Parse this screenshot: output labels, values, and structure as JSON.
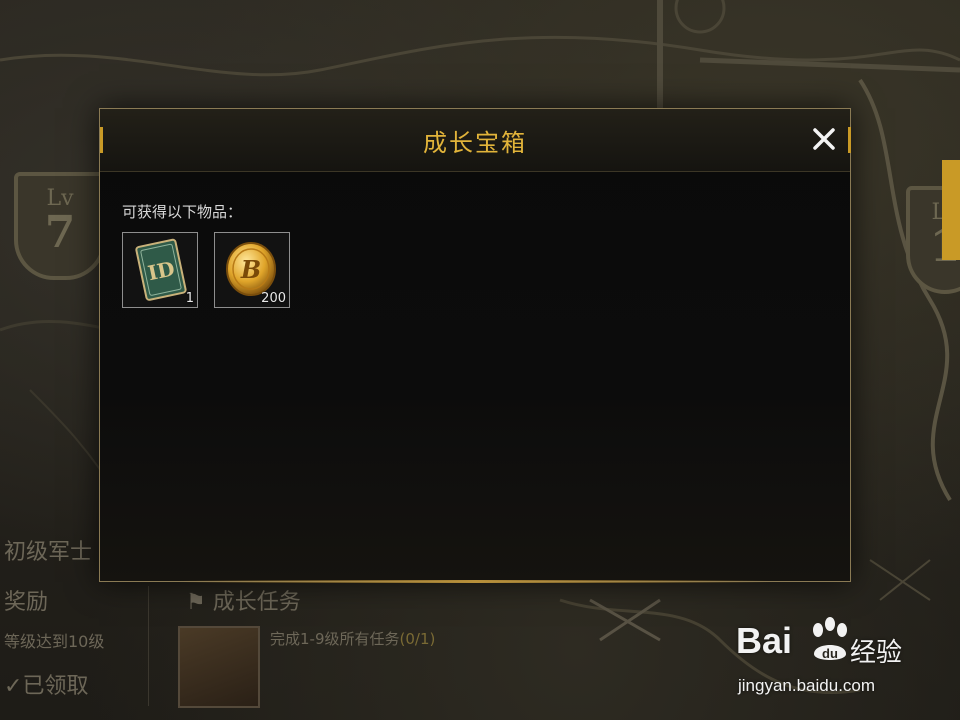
{
  "background": {
    "level_badge_left": {
      "lv": "Lv",
      "number": "7"
    },
    "level_badge_right": {
      "lv": "Lv",
      "number": "1"
    },
    "rank_label": "初级军士",
    "reward_label": "奖励",
    "level_requirement": "等级达到10级",
    "claimed_label": "已领取",
    "growth_task_label": "成长任务",
    "task_description": "完成1-9级所有任务",
    "task_progress": "(0/1)"
  },
  "dialog": {
    "title": "成长宝箱",
    "close_icon": "close-icon",
    "subtitle": "可获得以下物品：",
    "items": [
      {
        "icon": "id-card-icon",
        "quantity": "1"
      },
      {
        "icon": "bp-coin-icon",
        "quantity": "200"
      }
    ]
  },
  "watermark": {
    "logo_text": "Bai",
    "logo_suffix": "du",
    "label": "经验",
    "url": "jingyan.baidu.com"
  },
  "colors": {
    "accent_gold": "#e2b43a",
    "dialog_bg": "#0a0a0a",
    "border": "#8a7a54"
  }
}
